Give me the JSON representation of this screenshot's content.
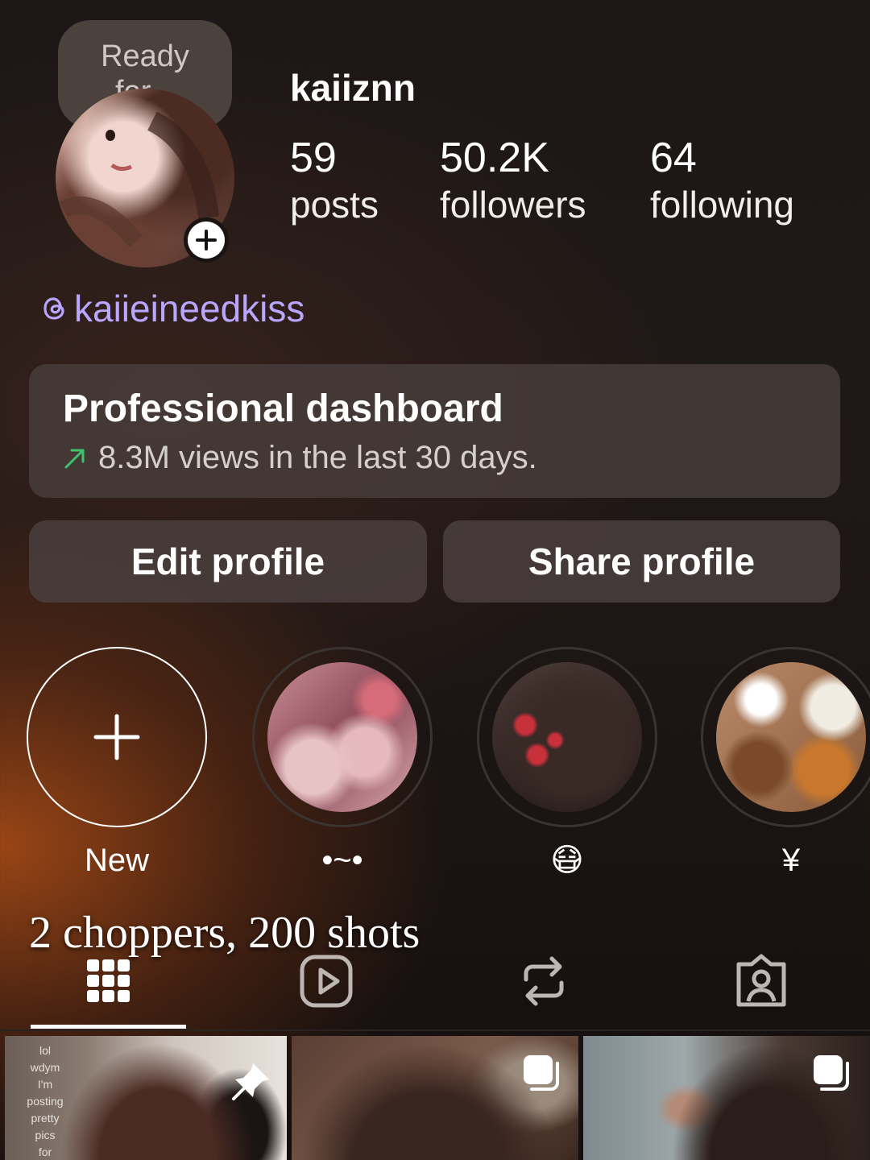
{
  "profile": {
    "note": "Ready\nfor...",
    "username": "kaiiznn",
    "stats": {
      "posts_count": "59",
      "posts_label": "posts",
      "followers_count": "50.2K",
      "followers_label": "followers",
      "following_count": "64",
      "following_label": "following"
    },
    "threads_handle": "kaiieineedkiss"
  },
  "dashboard": {
    "title": "Professional dashboard",
    "subtitle": "8.3M views in the last 30 days.",
    "trend_color": "#3ec46d"
  },
  "actions": {
    "edit_label": "Edit profile",
    "share_label": "Share profile"
  },
  "highlights": [
    {
      "label": "New"
    },
    {
      "label": "•~•"
    },
    {
      "label": "😷"
    },
    {
      "label": "¥"
    }
  ],
  "overlay_caption": "2 choppers, 200 shots",
  "tabs": [
    {
      "icon": "grid-icon"
    },
    {
      "icon": "reels-icon"
    },
    {
      "icon": "reposts-icon"
    },
    {
      "icon": "tagged-icon"
    }
  ],
  "grid": {
    "tile1_text": "lol\nwdym\nI'm\nposting\npretty\npics\nfor"
  },
  "colors": {
    "accent_link": "#b9a6ff",
    "surface": "#4a403e"
  }
}
